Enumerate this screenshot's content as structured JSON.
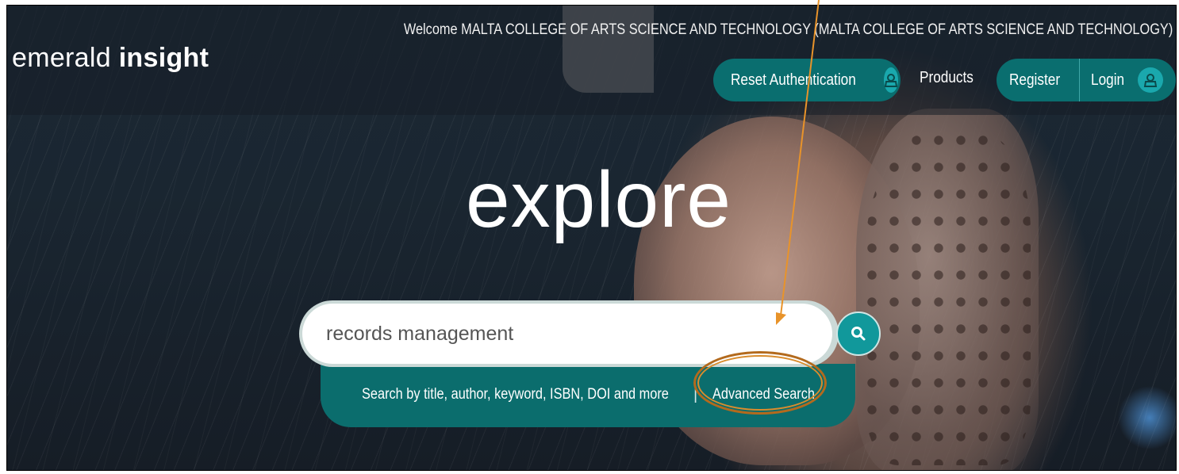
{
  "header": {
    "logo_light": "emerald",
    "logo_bold": "insight",
    "welcome_text": "Welcome MALTA COLLEGE OF ARTS SCIENCE AND TECHNOLOGY (MALTA COLLEGE OF ARTS SCIENCE AND TECHNOLOGY)",
    "reset_auth_label": "Reset Authentication",
    "products_label": "Products",
    "register_label": "Register",
    "login_label": "Login"
  },
  "hero": {
    "title": "explore"
  },
  "search": {
    "value": "records management",
    "hint": "Search by title, author, keyword, ISBN, DOI and more",
    "divider": "|",
    "advanced_label": "Advanced Search"
  },
  "colors": {
    "teal_dark": "#0b6d6d",
    "teal_light": "#11989b",
    "annotation": "#e8932a"
  }
}
